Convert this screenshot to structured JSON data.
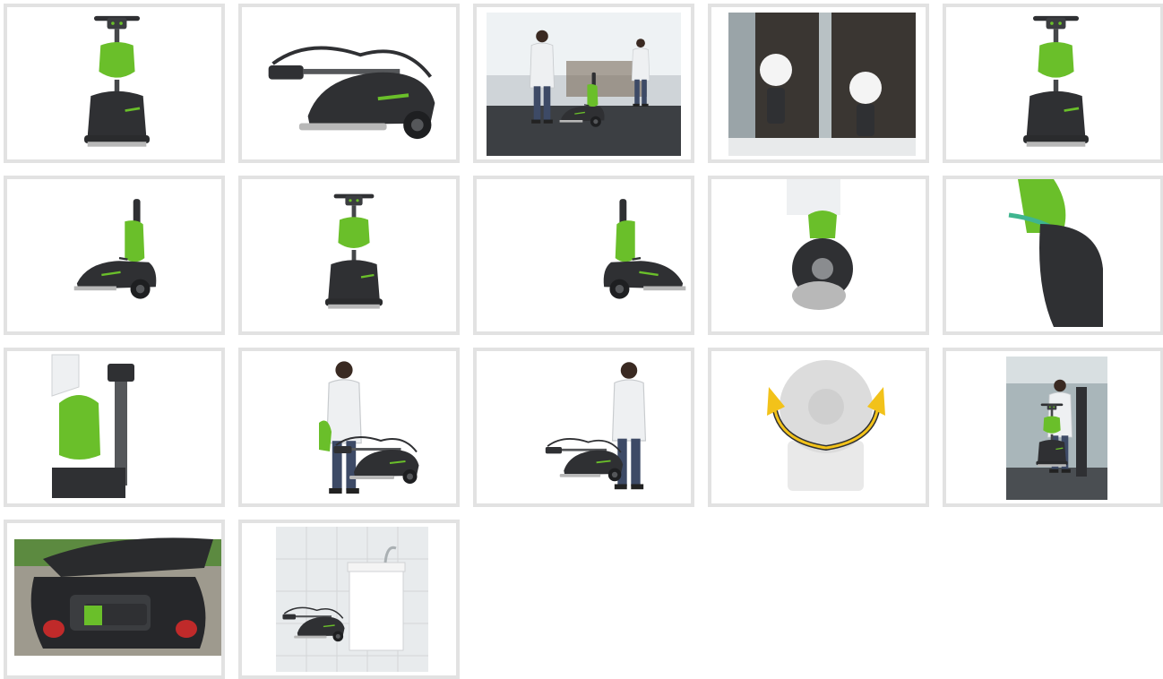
{
  "gallery": {
    "thumbnails": [
      {
        "id": 1,
        "kind": "product",
        "view": "front-three-quarter"
      },
      {
        "id": 2,
        "kind": "product",
        "view": "folded-side"
      },
      {
        "id": 3,
        "kind": "photo",
        "scene": "gym"
      },
      {
        "id": 4,
        "kind": "photo",
        "scene": "top-down-corridor"
      },
      {
        "id": 5,
        "kind": "product",
        "view": "front"
      },
      {
        "id": 6,
        "kind": "product",
        "view": "side-left"
      },
      {
        "id": 7,
        "kind": "product",
        "view": "rear"
      },
      {
        "id": 8,
        "kind": "product",
        "view": "side-right"
      },
      {
        "id": 9,
        "kind": "product",
        "view": "brush-underside"
      },
      {
        "id": 10,
        "kind": "product",
        "view": "hose-detail"
      },
      {
        "id": 11,
        "kind": "product",
        "view": "tank-removal"
      },
      {
        "id": 12,
        "kind": "photo",
        "scene": "operator-standing"
      },
      {
        "id": 13,
        "kind": "photo",
        "scene": "operator-folding"
      },
      {
        "id": 14,
        "kind": "diagram",
        "view": "brush-rotation"
      },
      {
        "id": 15,
        "kind": "photo",
        "scene": "office"
      },
      {
        "id": 16,
        "kind": "photo",
        "scene": "car-trunk"
      },
      {
        "id": 17,
        "kind": "photo",
        "scene": "storage-wall"
      }
    ]
  },
  "colors": {
    "tile_border": "#e2e2e2",
    "machine_green": "#6abf2a",
    "machine_dark": "#2f3033",
    "arrow_yellow": "#f2c21a"
  }
}
